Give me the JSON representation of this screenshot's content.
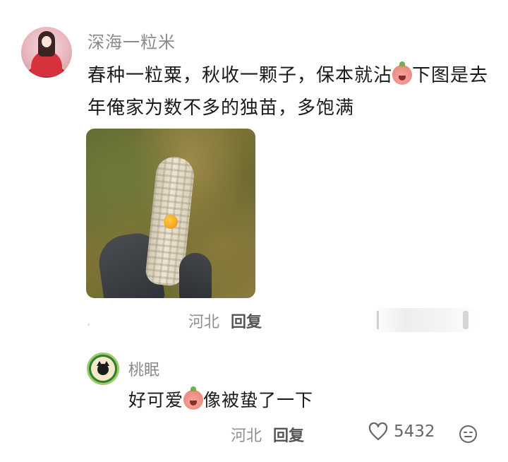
{
  "main_comment": {
    "username": "深海一粒米",
    "text_part1": "春种一粒粟，秋收一颗子，保本就沾",
    "text_part2": "下图是去年俺家为数不多的独苗，多饱满",
    "emoji": "laughing-tears-peach-emoji",
    "location": "河北",
    "reply_label": "回复"
  },
  "reply_comment": {
    "username": "桃眠",
    "text_part1": "好可爱",
    "text_part2": "像被蛰了一下",
    "emoji": "crying-peach-emoji",
    "location": "河北",
    "reply_label": "回复",
    "like_count": "5432",
    "like_icon": "heart-outline-icon",
    "react_icon": "emoji-face-icon"
  }
}
